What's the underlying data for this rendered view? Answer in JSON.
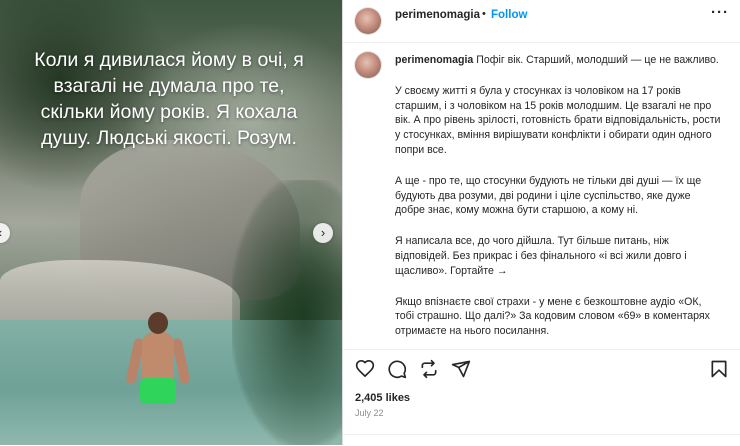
{
  "media": {
    "overlay_lines": [
      "Коли я дивилася йому в очі, я",
      "взагалі не думала про те,",
      "скільки йому років. Я кохала",
      "душу. Людські якості. Розум."
    ],
    "nav_left_icon": "chevron-left-icon",
    "nav_right_icon": "chevron-right-icon"
  },
  "header": {
    "username": "perimenomagia",
    "separator": "•",
    "follow_label": "Follow",
    "more_icon": "more-horizontal-icon",
    "more_glyph": "···"
  },
  "caption": {
    "username": "perimenomagia",
    "intro": "Пофіг вік. Старший, молодший — це не важливо.",
    "paragraphs": [
      "У своєму житті я була у стосунках із чоловіком на 17 років старшим, і з чоловіком на 15 років молодшим. Це взагалі не про вік. А про рівень зрілості, готовність брати відповідальність, рости у стосунках, вміння вирішувати конфлікти і обирати один одного попри все.",
      "А ще - про те, що стосунки будують не тільки дві душі — їх ще будують два розуми, дві родини і ціле суспільство, яке дуже добре знає, кому можна бути старшою, а кому ні.",
      "Я написала все, до чого дійшла. Тут більше питань, ніж відповідей. Без прикрас і без фінального «і всі жили довго і щасливо». Гортайте →",
      "Якщо впізнаєте свої страхи - у мене є безкоштовне аудіо «ОК, тобі страшно. Що далі?» За кодовим словом «69» в коментарях отримаєте на нього посилання."
    ]
  },
  "actions": {
    "like_icon": "heart-icon",
    "comment_icon": "comment-icon",
    "share_icon": "repost-icon",
    "send_icon": "send-icon",
    "save_icon": "bookmark-icon"
  },
  "likes": "2,405 likes",
  "date": "July 22"
}
